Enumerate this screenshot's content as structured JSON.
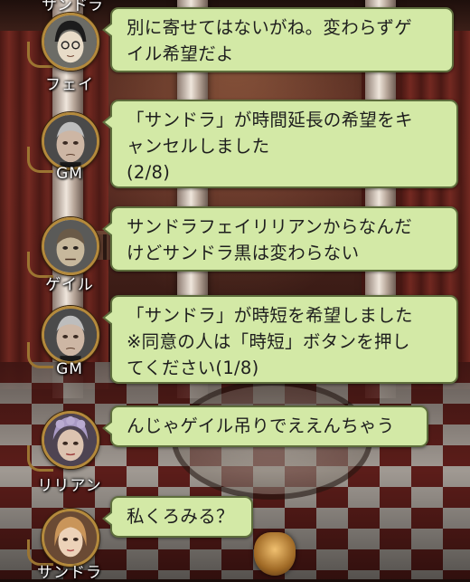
{
  "top_partial_name": "サンドラ",
  "messages": [
    {
      "speaker": "フェイ",
      "lines": [
        "別に寄せてはないがね。変わらずゲ",
        "イル希望だよ"
      ]
    },
    {
      "speaker": "GM",
      "lines": [
        "「サンドラ」が時間延長の希望をキ",
        "ャンセルしました",
        "(2/8)"
      ]
    },
    {
      "speaker": "ゲイル",
      "lines": [
        "サンドラフェイリリアンからなんだ",
        "けどサンドラ黒は変わらない"
      ]
    },
    {
      "speaker": "GM",
      "lines": [
        "「サンドラ」が時短を希望しました",
        "※同意の人は「時短」ボタンを押し",
        "てください(1/8)"
      ]
    },
    {
      "speaker": "リリアン",
      "lines": [
        "んじゃゲイル吊りでええんちゃう"
      ]
    },
    {
      "speaker": "サンドラ",
      "lines": [
        "私くろみる？"
      ]
    }
  ],
  "avatars": [
    "faye-portrait-icon",
    "gm-portrait-icon",
    "gale-portrait-icon",
    "gm-portrait-icon",
    "lillian-portrait-icon",
    "sandra-portrait-icon"
  ],
  "colors": {
    "bubble": "#d3e9a6",
    "bubble_border": "#5e6e3d",
    "avatar_frame": "#b48a3c"
  }
}
